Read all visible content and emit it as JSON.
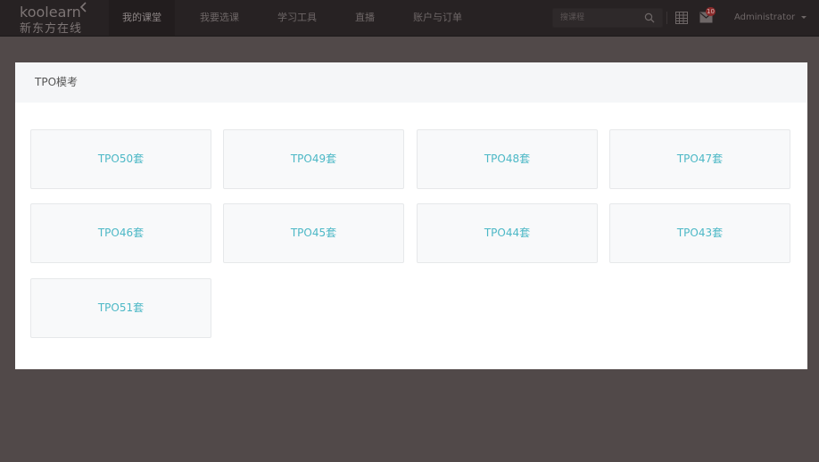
{
  "logo": {
    "en": "koolearn",
    "cn": "新东方在线"
  },
  "nav": {
    "items": [
      {
        "label": "我的课堂",
        "active": true
      },
      {
        "label": "我要选课",
        "active": false
      },
      {
        "label": "学习工具",
        "active": false
      },
      {
        "label": "直播",
        "active": false
      },
      {
        "label": "账户与订单",
        "active": false
      }
    ]
  },
  "search": {
    "placeholder": "搜课程"
  },
  "notifications": {
    "count": "10"
  },
  "user": {
    "name": "Administrator"
  },
  "panel": {
    "title": "TPO模考",
    "cards": [
      "TPO50套",
      "TPO49套",
      "TPO48套",
      "TPO47套",
      "TPO46套",
      "TPO45套",
      "TPO44套",
      "TPO43套",
      "TPO51套"
    ]
  },
  "colors": {
    "topbar": "#272223",
    "overlay_bg": "#514949",
    "card_text": "#4cb8c6"
  }
}
